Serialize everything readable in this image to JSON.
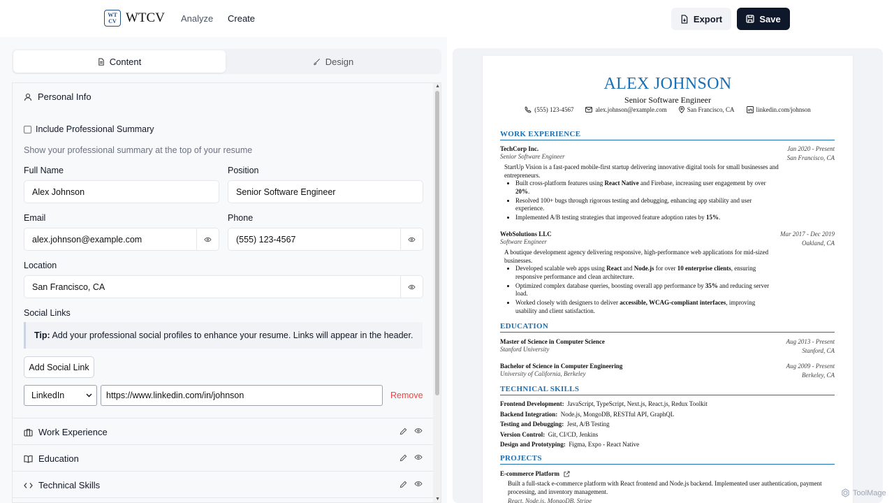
{
  "header": {
    "logo_text": "WT CV",
    "brand": "WTCV",
    "nav": [
      "Analyze",
      "Create"
    ],
    "export_label": "Export",
    "save_label": "Save"
  },
  "tabs": {
    "content": "Content",
    "design": "Design"
  },
  "personal": {
    "section_title": "Personal Info",
    "summary_checkbox_label": "Include Professional Summary",
    "summary_hint": "Show your professional summary at the top of your resume",
    "full_name_label": "Full Name",
    "full_name_value": "Alex Johnson",
    "position_label": "Position",
    "position_value": "Senior Software Engineer",
    "email_label": "Email",
    "email_value": "alex.johnson@example.com",
    "phone_label": "Phone",
    "phone_value": "(555) 123-4567",
    "location_label": "Location",
    "location_value": "San Francisco, CA",
    "social_label": "Social Links",
    "tip_bold": "Tip:",
    "tip_text": " Add your professional social profiles to enhance your resume. Links will appear in the header.",
    "add_social_label": "Add Social Link",
    "social_platform": "LinkedIn",
    "social_url": "https://www.linkedin.com/in/johnson",
    "remove_label": "Remove"
  },
  "sections": [
    "Work Experience",
    "Education",
    "Technical Skills"
  ],
  "resume": {
    "name": "ALEX JOHNSON",
    "title": "Senior Software Engineer",
    "phone": "(555) 123-4567",
    "email": "alex.johnson@example.com",
    "location": "San Francisco, CA",
    "linkedin": "linkedin.com/johnson",
    "work_heading": "WORK EXPERIENCE",
    "jobs": [
      {
        "company": "TechCorp Inc.",
        "role": "Senior Software Engineer",
        "dates": "Jan 2020 - Present",
        "place": "San Francisco, CA",
        "desc": "StartUp Vision is a fast-paced mobile-first startup delivering innovative digital tools for small businesses and entrepreneurs."
      },
      {
        "company": "WebSolutions LLC",
        "role": "Software Engineer",
        "dates": "Mar 2017 - Dec 2019",
        "place": "Oakland, CA",
        "desc": "A boutique development agency delivering responsive, high-performance web applications for mid-sized businesses."
      }
    ],
    "edu_heading": "EDUCATION",
    "edu": [
      {
        "degree": "Master of Science in Computer Science",
        "school": "Stanford University",
        "dates": "Aug 2013 - Present",
        "place": "Stanford, CA"
      },
      {
        "degree": "Bachelor of Science in Computer Engineering",
        "school": "University of California, Berkeley",
        "dates": "Aug 2009 - Present",
        "place": "Berkeley, CA"
      }
    ],
    "skills_heading": "TECHNICAL SKILLS",
    "skills": [
      {
        "label": "Frontend Development:",
        "value": "JavaScript, TypeScript, Next.js, React.js, Redux Toolkit"
      },
      {
        "label": "Backend Integration:",
        "value": "Node.js, MongoDB, RESTful API, GraphQL"
      },
      {
        "label": "Testing and Debugging:",
        "value": "Jest, A/B Testing"
      },
      {
        "label": "Version Control:",
        "value": "Git, CI/CD, Jenkins"
      },
      {
        "label": "Design and Prototyping:",
        "value": "Figma, Expo - React Native"
      }
    ],
    "projects_heading": "PROJECTS",
    "project_name": "E-commerce Platform",
    "project_desc": "Built a full-stack e-commerce platform with React frontend and Node.js backend. Implemented user authentication, payment processing, and inventory management.",
    "project_tech": "React, Node.js, MongoDB, Stripe"
  },
  "watermark": "ToolMage",
  "colors": {
    "accent": "#1a6fb5",
    "primary_button": "#0f172a",
    "danger": "#ef4444"
  }
}
